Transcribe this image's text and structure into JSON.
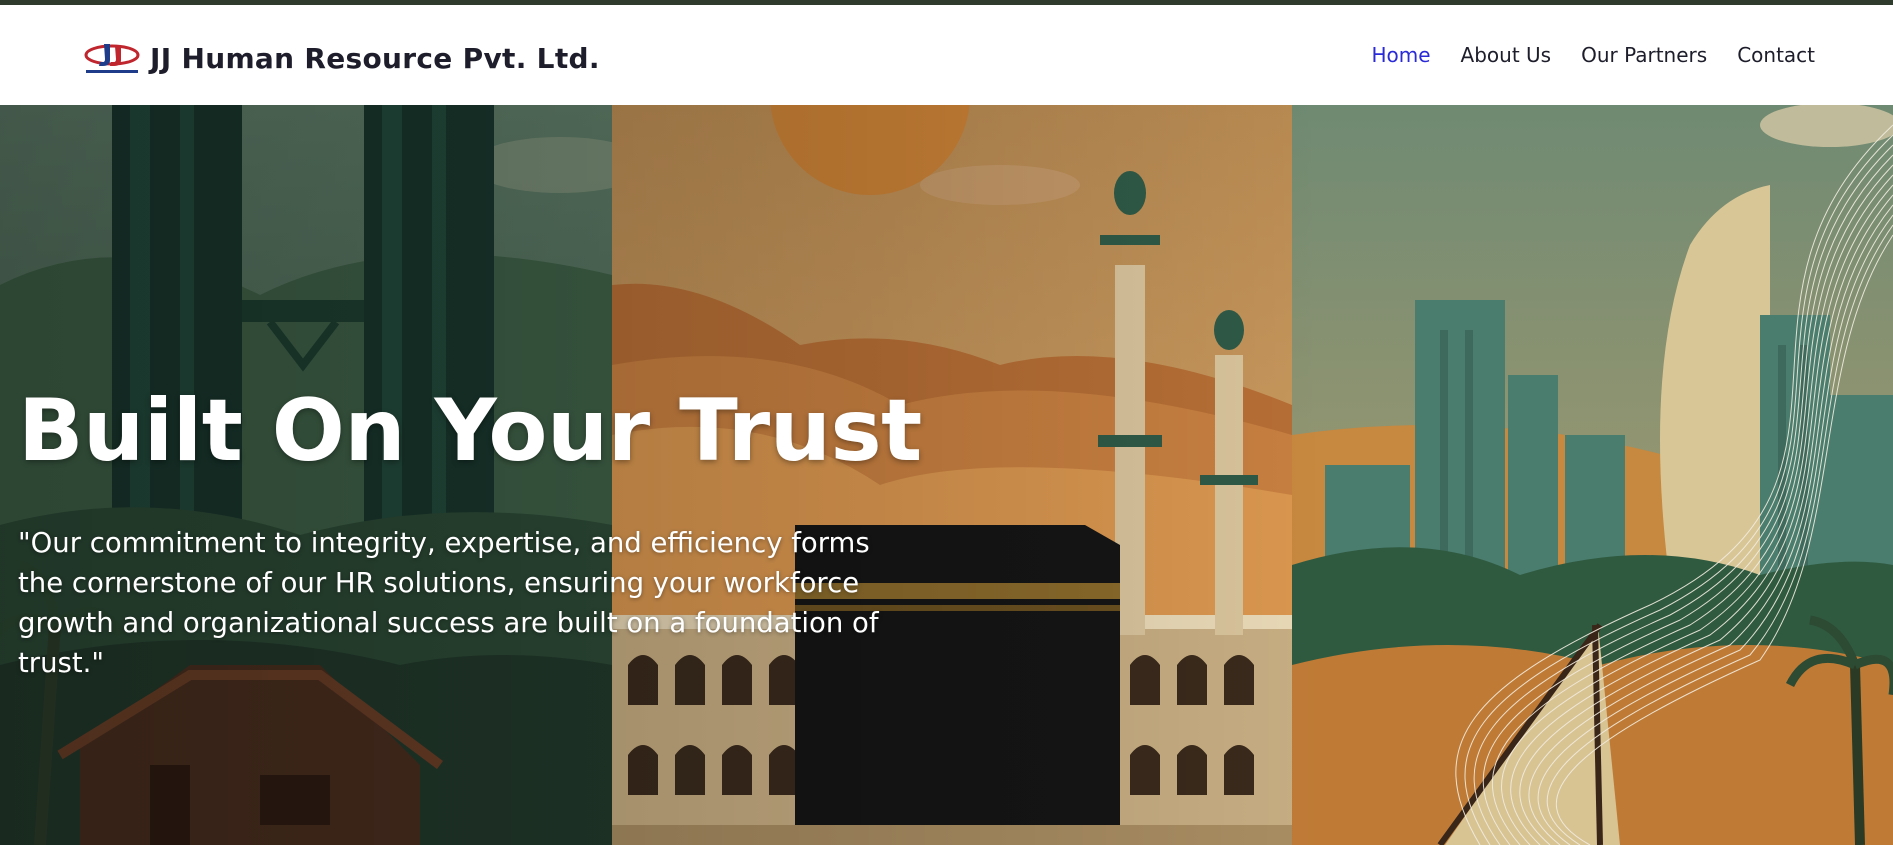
{
  "brand": {
    "name": "JJ Human Resource Pvt. Ltd.",
    "logo_icon": "jj-logo-icon"
  },
  "nav": {
    "items": [
      {
        "label": "Home",
        "active": true
      },
      {
        "label": "About Us",
        "active": false
      },
      {
        "label": "Our Partners",
        "active": false
      },
      {
        "label": "Contact",
        "active": false
      }
    ]
  },
  "hero": {
    "title": "Built On Your Trust",
    "text": "\"Our commitment to integrity, expertise, and efficiency forms the cornerstone of our HR solutions, ensuring your workforce growth and organizational success are built on a foundation of trust.\""
  },
  "colors": {
    "nav_active": "#2a2ad6",
    "nav_text": "#1d1d2b",
    "top_strip": "#2f3b2c"
  }
}
